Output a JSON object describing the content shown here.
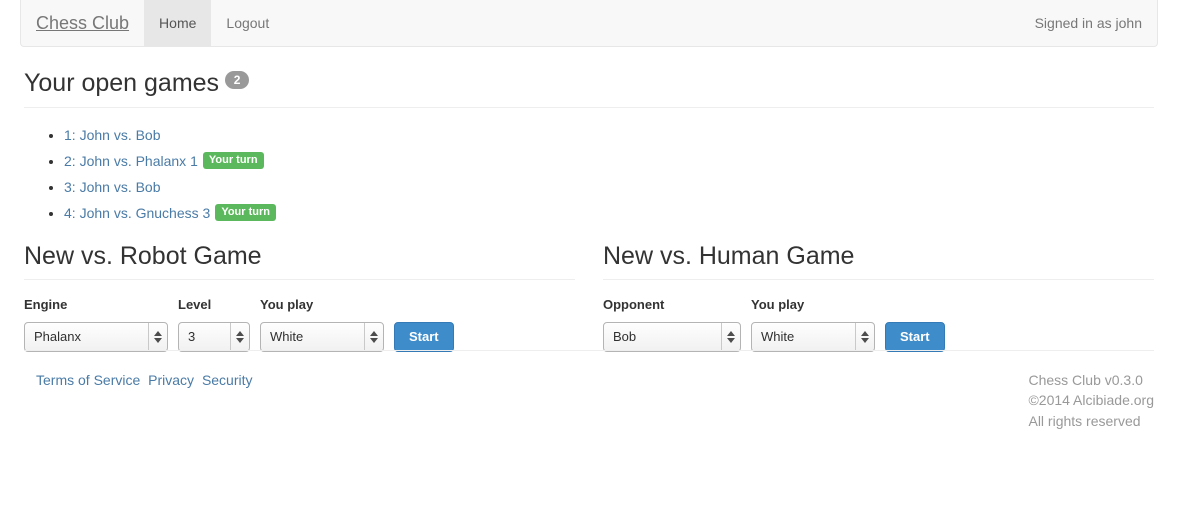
{
  "navbar": {
    "brand": "Chess Club",
    "items": [
      {
        "label": "Home",
        "active": true
      },
      {
        "label": "Logout",
        "active": false
      }
    ],
    "signed_in_text": "Signed in as john"
  },
  "open_games": {
    "title": "Your open games",
    "count_badge": "2",
    "items": [
      {
        "link": "1: John vs. Bob",
        "badge": ""
      },
      {
        "link": "2: John vs. Phalanx 1",
        "badge": "Your turn"
      },
      {
        "link": "3: John vs. Bob",
        "badge": ""
      },
      {
        "link": "4: John vs. Gnuchess 3",
        "badge": "Your turn"
      }
    ]
  },
  "robot_form": {
    "title": "New vs. Robot Game",
    "engine_label": "Engine",
    "engine_value": "Phalanx",
    "level_label": "Level",
    "level_value": "3",
    "play_label": "You play",
    "play_value": "White",
    "start_label": "Start"
  },
  "human_form": {
    "title": "New vs. Human Game",
    "opponent_label": "Opponent",
    "opponent_value": "Bob",
    "play_label": "You play",
    "play_value": "White",
    "start_label": "Start"
  },
  "footer": {
    "links": [
      {
        "label": "Terms of Service"
      },
      {
        "label": "Privacy"
      },
      {
        "label": "Security"
      }
    ],
    "version": "Chess Club v0.3.0",
    "copyright": "©2014 Alcibiade.org",
    "rights": "All rights reserved"
  },
  "colors": {
    "link": "#4a7ba6",
    "primary": "#3f8ccb",
    "success": "#5cb85c",
    "badge": "#999999",
    "navbar_bg": "#f8f8f8"
  }
}
